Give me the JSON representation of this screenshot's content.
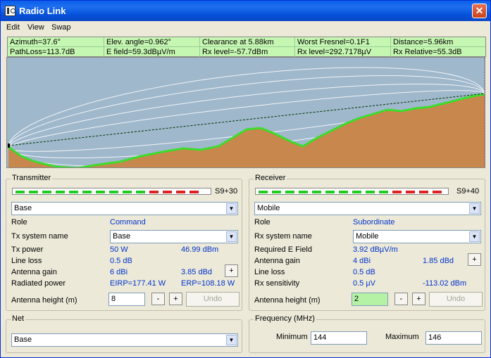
{
  "window": {
    "title": "Radio Link",
    "close_glyph": "✕"
  },
  "menu": [
    "Edit",
    "View",
    "Swap"
  ],
  "info": {
    "row1": [
      "Azimuth=37.6°",
      "Elev. angle=0.962°",
      "Clearance at 5.88km",
      "Worst Fresnel=0.1F1",
      "Distance=5.96km"
    ],
    "row2": [
      "PathLoss=113.7dB",
      "E field=59.3dBµV/m",
      "Rx level=-57.7dBm",
      "Rx level=292.7178µV",
      "Rx Relative=55.3dB"
    ]
  },
  "colors": {
    "terrain": "#C8874C",
    "terrain_edge": "#3DDC2C",
    "sky": "#9FB8CC",
    "signal_green": "#22CC22",
    "signal_red": "#DD2222"
  },
  "transmitter": {
    "title": "Transmitter",
    "signal_text": "S9+30",
    "signal_green_count": 10,
    "signal_red_count": 4,
    "unit": "Base",
    "role_label": "Role",
    "role_value": "Command",
    "system_label": "Tx system name",
    "system_value": "Base",
    "power_label": "Tx power",
    "power_w": "50 W",
    "power_dbm": "46.99 dBm",
    "lineloss_label": "Line loss",
    "lineloss_value": "0.5 dB",
    "gain_label": "Antenna gain",
    "gain_dbi": "6 dBi",
    "gain_dbd": "3.85 dBd",
    "radiated_label": "Radiated power",
    "eirp": "EIRP=177.41 W",
    "erp": "ERP=108.18 W",
    "height_label": "Antenna height (m)",
    "height_value": "8",
    "minus": "-",
    "plus": "+",
    "undo": "Undo"
  },
  "receiver": {
    "title": "Receiver",
    "signal_text": "S9+40",
    "signal_green_count": 10,
    "signal_red_count": 4,
    "unit": "Mobile",
    "role_label": "Role",
    "role_value": "Subordinate",
    "system_label": "Rx system name",
    "system_value": "Mobile",
    "efield_label": "Required E Field",
    "efield_value": "3.92 dBµV/m",
    "gain_label": "Antenna gain",
    "gain_dbi": "4 dBi",
    "gain_dbd": "1.85 dBd",
    "lineloss_label": "Line loss",
    "lineloss_value": "0.5 dB",
    "sens_label": "Rx sensitivity",
    "sens_uv": "0.5 µV",
    "sens_dbm": "-113.02 dBm",
    "height_label": "Antenna height (m)",
    "height_value": "2",
    "minus": "-",
    "plus": "+",
    "undo": "Undo"
  },
  "net": {
    "title": "Net",
    "value": "Base"
  },
  "frequency": {
    "title": "Frequency (MHz)",
    "min_label": "Minimum",
    "min_value": "144",
    "max_label": "Maximum",
    "max_value": "146"
  }
}
